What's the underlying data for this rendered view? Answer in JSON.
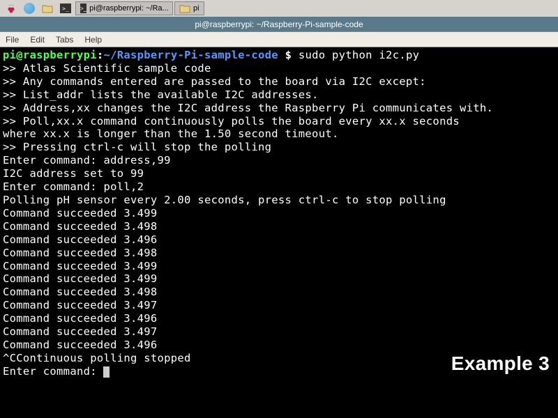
{
  "taskbar": {
    "rpi_logo": "raspberry",
    "tab1_label": "pi@raspberrypi: ~/Ra...",
    "tab2_label": "pi"
  },
  "window": {
    "title": "pi@raspberrypi: ~/Raspberry-Pi-sample-code"
  },
  "menu": {
    "file": "File",
    "edit": "Edit",
    "tabs": "Tabs",
    "help": "Help"
  },
  "prompt": {
    "user_host": "pi@raspberrypi",
    "colon": ":",
    "path": "~/Raspberry-Pi-sample-code",
    "dollar": " $ ",
    "command": "sudo python i2c.py"
  },
  "output": {
    "l0": ">> Atlas Scientific sample code",
    "l1": ">> Any commands entered are passed to the board via I2C except:",
    "l2": ">>   List_addr lists the available I2C addresses.",
    "l3": ">>   Address,xx changes the I2C address the Raspberry Pi communicates with.",
    "l4": ">>   Poll,xx.x command continuously polls the board every xx.x seconds",
    "l5": " where xx.x is longer than the 1.50 second timeout.",
    "l6": ">> Pressing ctrl-c will stop the polling",
    "l7": "Enter command: address,99",
    "l8": "I2C address set to 99",
    "l9": "Enter command: poll,2",
    "l10": "Polling pH sensor every 2.00 seconds, press ctrl-c to stop polling",
    "l11": "Command succeeded 3.499",
    "l12": "Command succeeded 3.498",
    "l13": "Command succeeded 3.496",
    "l14": "Command succeeded 3.498",
    "l15": "Command succeeded 3.499",
    "l16": "Command succeeded 3.499",
    "l17": "Command succeeded 3.498",
    "l18": "Command succeeded 3.497",
    "l19": "Command succeeded 3.496",
    "l20": "Command succeeded 3.497",
    "l21": "Command succeeded 3.496",
    "l22": "^CContinuous polling stopped",
    "l23": "Enter command: "
  },
  "badge": {
    "text": "Example 3"
  }
}
